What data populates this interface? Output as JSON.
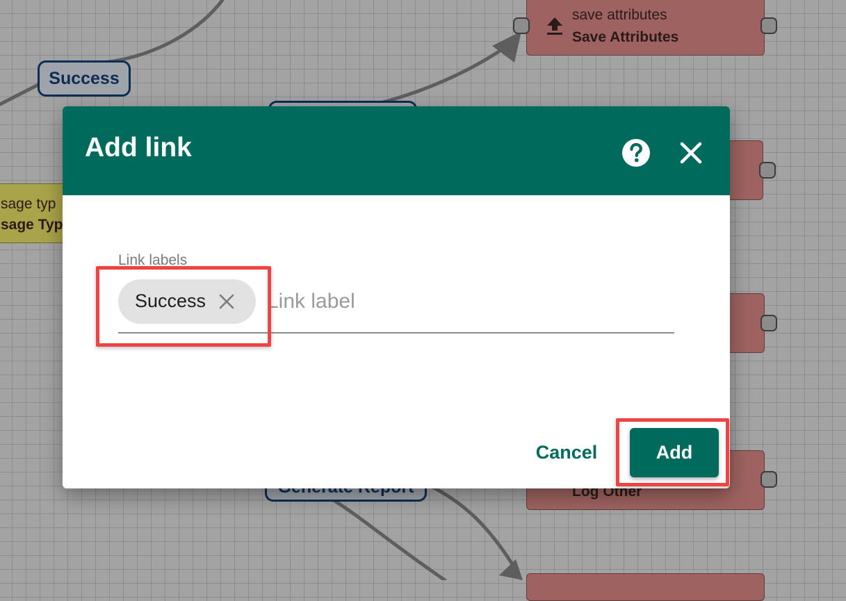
{
  "background_nodes": {
    "save_node": {
      "type": "save attributes",
      "name": "Save Attributes",
      "icon": "upload-icon"
    },
    "log_node": {
      "name": "Log Other"
    },
    "yellow_node": {
      "type": "sage typ",
      "name": "sage Typ"
    }
  },
  "background_links": {
    "left_label": "Success",
    "bottom_label": "Generate Report"
  },
  "dialog": {
    "title": "Add link",
    "help_icon": "help-circle-icon",
    "close_icon": "close-icon",
    "field_label": "Link labels",
    "chips": [
      "Success"
    ],
    "chip_remove_icon": "close-x-icon",
    "input_value": "",
    "input_placeholder": "Link label",
    "cancel_label": "Cancel",
    "add_label": "Add"
  },
  "colors": {
    "header": "#006b5d",
    "primary": "#006b5d",
    "highlight": "#ef4444",
    "node": "#9e6360",
    "node_yellow": "#a9a44a",
    "link_label_border": "#0e2d55"
  }
}
